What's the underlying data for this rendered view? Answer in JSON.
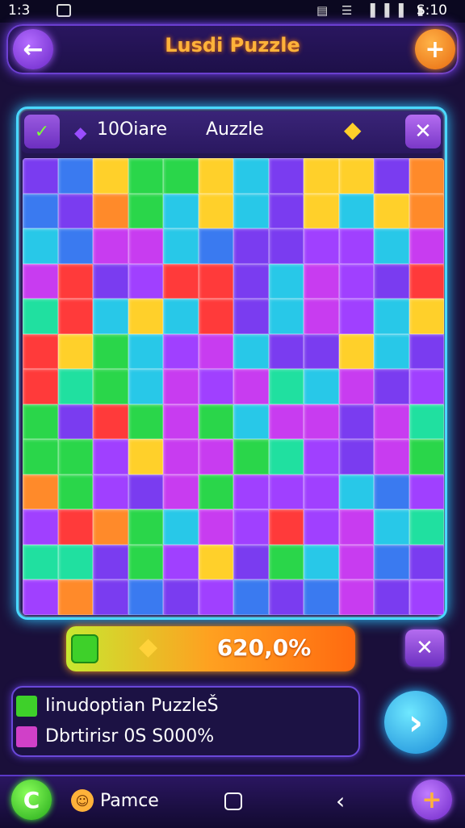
{
  "status_bar": {
    "time": "1:3",
    "right_text": "S:10",
    "icons_text": "▤ ☰ ▐▐▐ ▮"
  },
  "header": {
    "title": "Lusdi Puzzle",
    "back_icon": "←",
    "plus_icon": "+"
  },
  "toolbar": {
    "count": "10Oiare",
    "name": "Auzzle",
    "left_icon": "✓",
    "gem_icon": "◆",
    "shield_icon": "◆",
    "close_icon": "✕"
  },
  "puzzle": {
    "colors": [
      "#7a3cf0",
      "#28c8e8",
      "#2ad64a",
      "#ff3a3a",
      "#ffd02a",
      "#c83cf0",
      "#ff8a2a",
      "#3a7af0",
      "#20e0a0",
      "#a040ff"
    ],
    "grid": [
      [
        0,
        7,
        4,
        2,
        2,
        4,
        1,
        0,
        4,
        4,
        0,
        6
      ],
      [
        7,
        0,
        6,
        2,
        1,
        4,
        1,
        0,
        4,
        1,
        4,
        6
      ],
      [
        1,
        7,
        5,
        5,
        1,
        7,
        0,
        0,
        9,
        9,
        1,
        5
      ],
      [
        5,
        3,
        0,
        9,
        3,
        3,
        0,
        1,
        5,
        9,
        0,
        3
      ],
      [
        8,
        3,
        1,
        4,
        1,
        3,
        0,
        1,
        5,
        9,
        1,
        4
      ],
      [
        3,
        4,
        2,
        1,
        9,
        5,
        1,
        0,
        0,
        4,
        1,
        0
      ],
      [
        3,
        8,
        2,
        1,
        5,
        9,
        5,
        8,
        1,
        5,
        0,
        9
      ],
      [
        2,
        0,
        3,
        2,
        5,
        2,
        1,
        5,
        5,
        0,
        5,
        8
      ],
      [
        2,
        2,
        9,
        4,
        5,
        5,
        2,
        8,
        9,
        0,
        5,
        2
      ],
      [
        6,
        2,
        9,
        0,
        5,
        2,
        9,
        9,
        9,
        1,
        7,
        9
      ],
      [
        9,
        3,
        6,
        2,
        1,
        5,
        9,
        3,
        9,
        5,
        1,
        8
      ],
      [
        8,
        8,
        0,
        2,
        9,
        4,
        0,
        2,
        1,
        5,
        7,
        0
      ],
      [
        9,
        6,
        0,
        7,
        0,
        9,
        7,
        0,
        7,
        5,
        0,
        9
      ]
    ]
  },
  "progress": {
    "value_text": "620,0%",
    "check_icon": "✓",
    "shield_icon": "◆",
    "close_icon": "✕"
  },
  "info": {
    "line1": "Iinudoptian PuzzleŠ",
    "line2": "Dbrtirisr 0S S000%"
  },
  "next_button": {
    "icon": "›"
  },
  "bottom_bar": {
    "c_icon": "C",
    "face_icon": "☺",
    "label": "Pamce",
    "back_icon": "‹",
    "plus_icon": "+"
  }
}
